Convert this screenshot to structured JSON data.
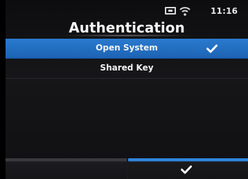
{
  "status_bar": {
    "time": "11:16",
    "icons": [
      "sd-card-icon",
      "wifi-icon"
    ]
  },
  "header": {
    "title": "Authentication"
  },
  "options": [
    {
      "label": "Open System",
      "selected": true
    },
    {
      "label": "Shared Key",
      "selected": false
    }
  ],
  "footer": {
    "left_button": "back",
    "right_button": "confirm-check-icon"
  },
  "colors": {
    "accent": "#2a7bd0",
    "background": "#121214",
    "text": "#f2f2f2"
  }
}
